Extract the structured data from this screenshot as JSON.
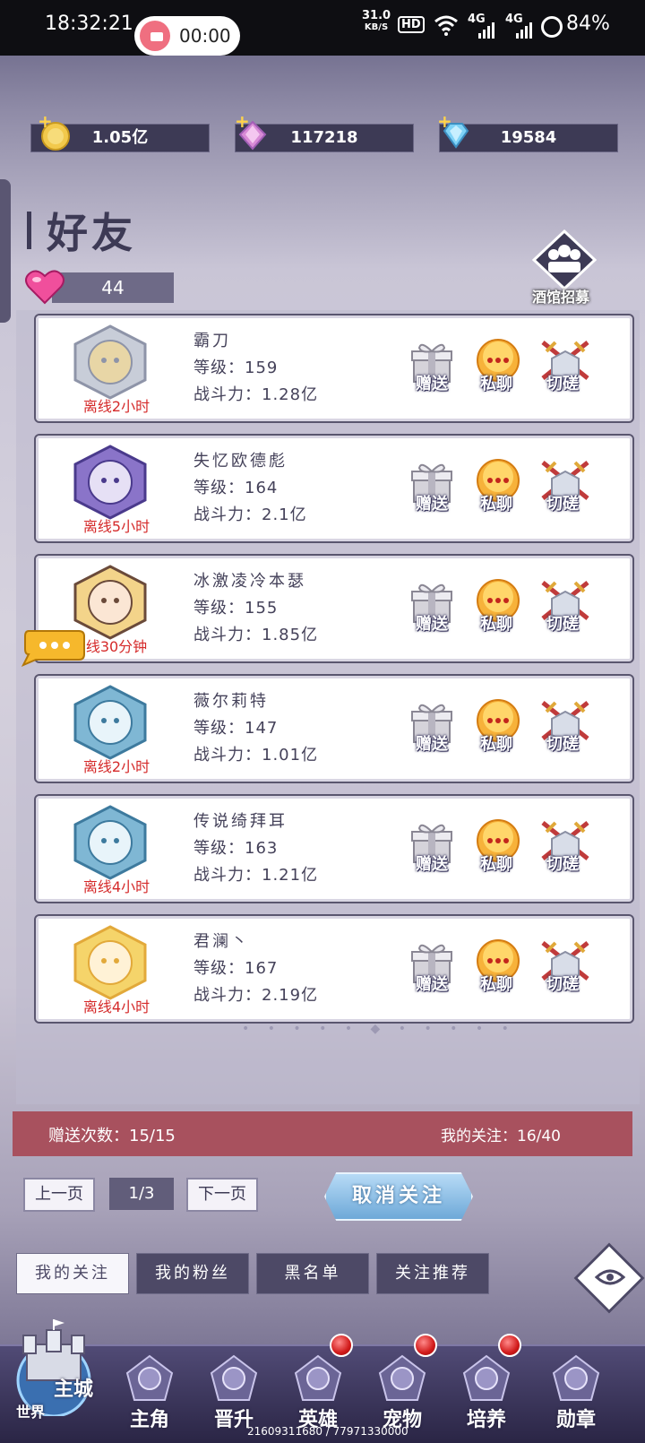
{
  "status_bar": {
    "time": "18:32:21",
    "recording_time": "00:00",
    "net_speed_value": "31.0",
    "net_speed_unit": "KB/S",
    "hd_label": "HD",
    "network_1": "4G",
    "network_2": "4G",
    "battery": "84%"
  },
  "currencies": [
    {
      "name": "gold",
      "value": "1.05亿",
      "color": "#f2c94c"
    },
    {
      "name": "crystal",
      "value": "117218",
      "color": "#d88bd6"
    },
    {
      "name": "diamond",
      "value": "19584",
      "color": "#7fd3f7"
    }
  ],
  "header": {
    "title": "好友",
    "hearts": "44",
    "tavern_label": "酒馆招募"
  },
  "friends": [
    {
      "name": "霸刀",
      "level_label": "等级：",
      "level": "159",
      "power_label": "战斗力：",
      "power": "1.28亿",
      "status": "离线2小时",
      "avatar": "silver-knight-avatar"
    },
    {
      "name": "失忆欧德彪",
      "level_label": "等级：",
      "level": "164",
      "power_label": "战斗力：",
      "power": "2.1亿",
      "status": "离线5小时",
      "avatar": "purple-dragon-avatar"
    },
    {
      "name": "冰激凌冷本瑟",
      "level_label": "等级：",
      "level": "155",
      "power_label": "战斗力：",
      "power": "1.85亿",
      "status": "线30分钟",
      "avatar": "dark-hair-girl-avatar"
    },
    {
      "name": "薇尔莉特",
      "level_label": "等级：",
      "level": "147",
      "power_label": "战斗力：",
      "power": "1.01亿",
      "status": "离线2小时",
      "avatar": "blue-shark-avatar"
    },
    {
      "name": "传说绮拜耳",
      "level_label": "等级：",
      "level": "163",
      "power_label": "战斗力：",
      "power": "1.21亿",
      "status": "离线4小时",
      "avatar": "blue-shark-avatar"
    },
    {
      "name": "君澜丶",
      "level_label": "等级：",
      "level": "167",
      "power_label": "战斗力：",
      "power": "2.19亿",
      "status": "离线4小时",
      "avatar": "blonde-girl-avatar"
    }
  ],
  "actions": {
    "gift": "赠送",
    "chat": "私聊",
    "duel": "切磋"
  },
  "info_bar": {
    "gift_count": "赠送次数：15/15",
    "follow_count": "我的关注：16/40"
  },
  "pagination": {
    "prev": "上一页",
    "page": "1/3",
    "next": "下一页",
    "unfollow": "取消关注"
  },
  "tabs": [
    {
      "label": "我的关注",
      "active": true
    },
    {
      "label": "我的粉丝",
      "active": false
    },
    {
      "label": "黑名单",
      "active": false
    },
    {
      "label": "关注推荐",
      "active": false
    }
  ],
  "nav": {
    "main_city": "主城",
    "world": "世界",
    "items": [
      {
        "label": "主角",
        "badge": false,
        "icon": "hero-head-icon"
      },
      {
        "label": "晋升",
        "badge": false,
        "icon": "promotion-icon"
      },
      {
        "label": "英雄",
        "badge": true,
        "icon": "helmet-icon"
      },
      {
        "label": "宠物",
        "badge": true,
        "icon": "pet-icon"
      },
      {
        "label": "培养",
        "badge": true,
        "icon": "training-icon"
      },
      {
        "label": "勋章",
        "badge": false,
        "icon": "medal-icon"
      }
    ]
  },
  "footer_ids": "21609311680 / 77971330000"
}
